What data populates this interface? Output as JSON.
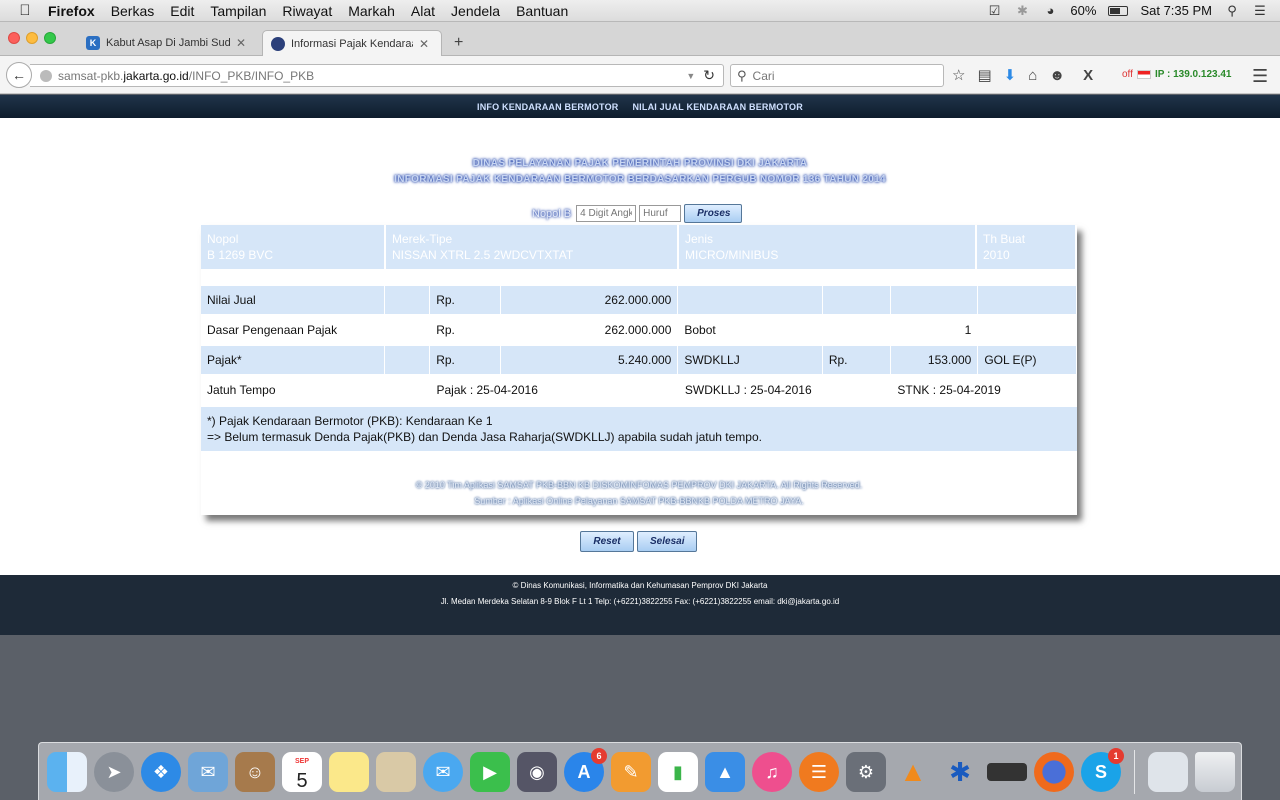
{
  "menubar": {
    "app": "Firefox",
    "items": [
      "Berkas",
      "Edit",
      "Tampilan",
      "Riwayat",
      "Markah",
      "Alat",
      "Jendela",
      "Bantuan"
    ],
    "battery": "60%",
    "clock": "Sat 7:35 PM"
  },
  "tabs": [
    {
      "title": "Kabut Asap Di Jambi Sudah...",
      "favicon": "K"
    },
    {
      "title": "Informasi Pajak Kendaraan ...",
      "favicon": ""
    }
  ],
  "navbar": {
    "url_prefix": "samsat-pkb.",
    "url_domain": "jakarta.go.id",
    "url_path": "/INFO_PKB/INFO_PKB",
    "search_placeholder": "Cari",
    "ip_status": "off",
    "ip_text": "IP : 139.0.123.41"
  },
  "page": {
    "topnav": [
      "INFO KENDARAAN BERMOTOR",
      "NILAI JUAL KENDARAAN BERMOTOR"
    ],
    "heading_line1": "DINAS PELAYANAN PAJAK PEMERINTAH PROVINSI DKI JAKARTA",
    "heading_line2": "INFORMASI PAJAK KENDARAAN BERMOTOR BERDASARKAN PERGUB NOMOR 136 TAHUN 2014",
    "form": {
      "label": "Nopol B",
      "digit_placeholder": "4 Digit Angk",
      "huruf_placeholder": "Huruf",
      "submit": "Proses"
    },
    "vehicle": {
      "nopol_label": "Nopol",
      "nopol": "B 1269 BVC",
      "merek_label": "Merek-Tipe",
      "merek": "NISSAN XTRL 2.5 2WDCVTXTAT",
      "jenis_label": "Jenis",
      "jenis": "MICRO/MINIBUS",
      "th_label": "Th Buat",
      "th": "2010"
    },
    "rows": {
      "nilai_jual_label": "Nilai Jual",
      "nilai_jual_cur": "Rp.",
      "nilai_jual": "262.000.000",
      "dasar_label": "Dasar Pengenaan Pajak",
      "dasar_cur": "Rp.",
      "dasar": "262.000.000",
      "bobot_label": "Bobot",
      "bobot": "1",
      "pajak_label": "Pajak*",
      "pajak_cur": "Rp.",
      "pajak": "5.240.000",
      "swdkllj_label": "SWDKLLJ",
      "swdkllj_cur": "Rp.",
      "swdkllj": "153.000",
      "gol": "GOL E(P)",
      "jatuh_label": "Jatuh Tempo",
      "jatuh_pajak": "Pajak : 25-04-2016",
      "jatuh_swdkllj": "SWDKLLJ : 25-04-2016",
      "jatuh_stnk": "STNK : 25-04-2019"
    },
    "note_line1": "*) Pajak Kendaraan Bermotor (PKB): Kendaraan Ke 1",
    "note_line2": "=> Belum termasuk Denda Pajak(PKB) dan Denda Jasa Raharja(SWDKLLJ) apabila sudah jatuh tempo.",
    "copyright1": "© 2010 Tim Aplikasi SAMSAT PKB-BBN KB DISKOMINFOMAS PEMPROV DKI JAKARTA. All Rights Reserved.",
    "copyright2": "Sumber : Aplikasi Online Pelayanan SAMSAT PKB-BBNKB POLDA METRO JAYA.",
    "reset_label": "Reset",
    "selesai_label": "Selesai",
    "footer1": "© Dinas Komunikasi, Informatika dan Kehumasan Pemprov DKI Jakarta",
    "footer2": "Jl. Medan Merdeka Selatan 8-9 Blok F Lt 1 Telp: (+6221)3822255 Fax: (+6221)3822255 email: dki@jakarta.go.id"
  },
  "dock": {
    "calendar_month": "SEP",
    "calendar_day": "5",
    "appstore_badge": "6",
    "skype_badge": "1"
  }
}
